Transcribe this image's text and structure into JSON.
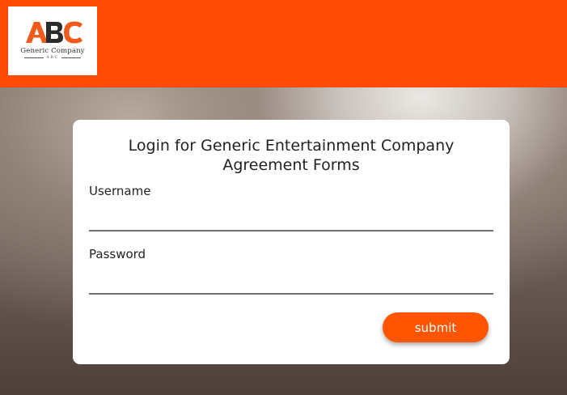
{
  "header": {
    "background_color": "#ff4a05",
    "logo": {
      "mark_text": "ABC",
      "name": "Generic Company",
      "sub": "ABC"
    }
  },
  "login": {
    "title": "Login for Generic Entertainment Company Agreement Forms",
    "username_label": "Username",
    "username_value": "",
    "password_label": "Password",
    "password_value": "",
    "submit_label": "submit"
  },
  "colors": {
    "accent": "#ff5400",
    "card_background": "#ffffff"
  }
}
